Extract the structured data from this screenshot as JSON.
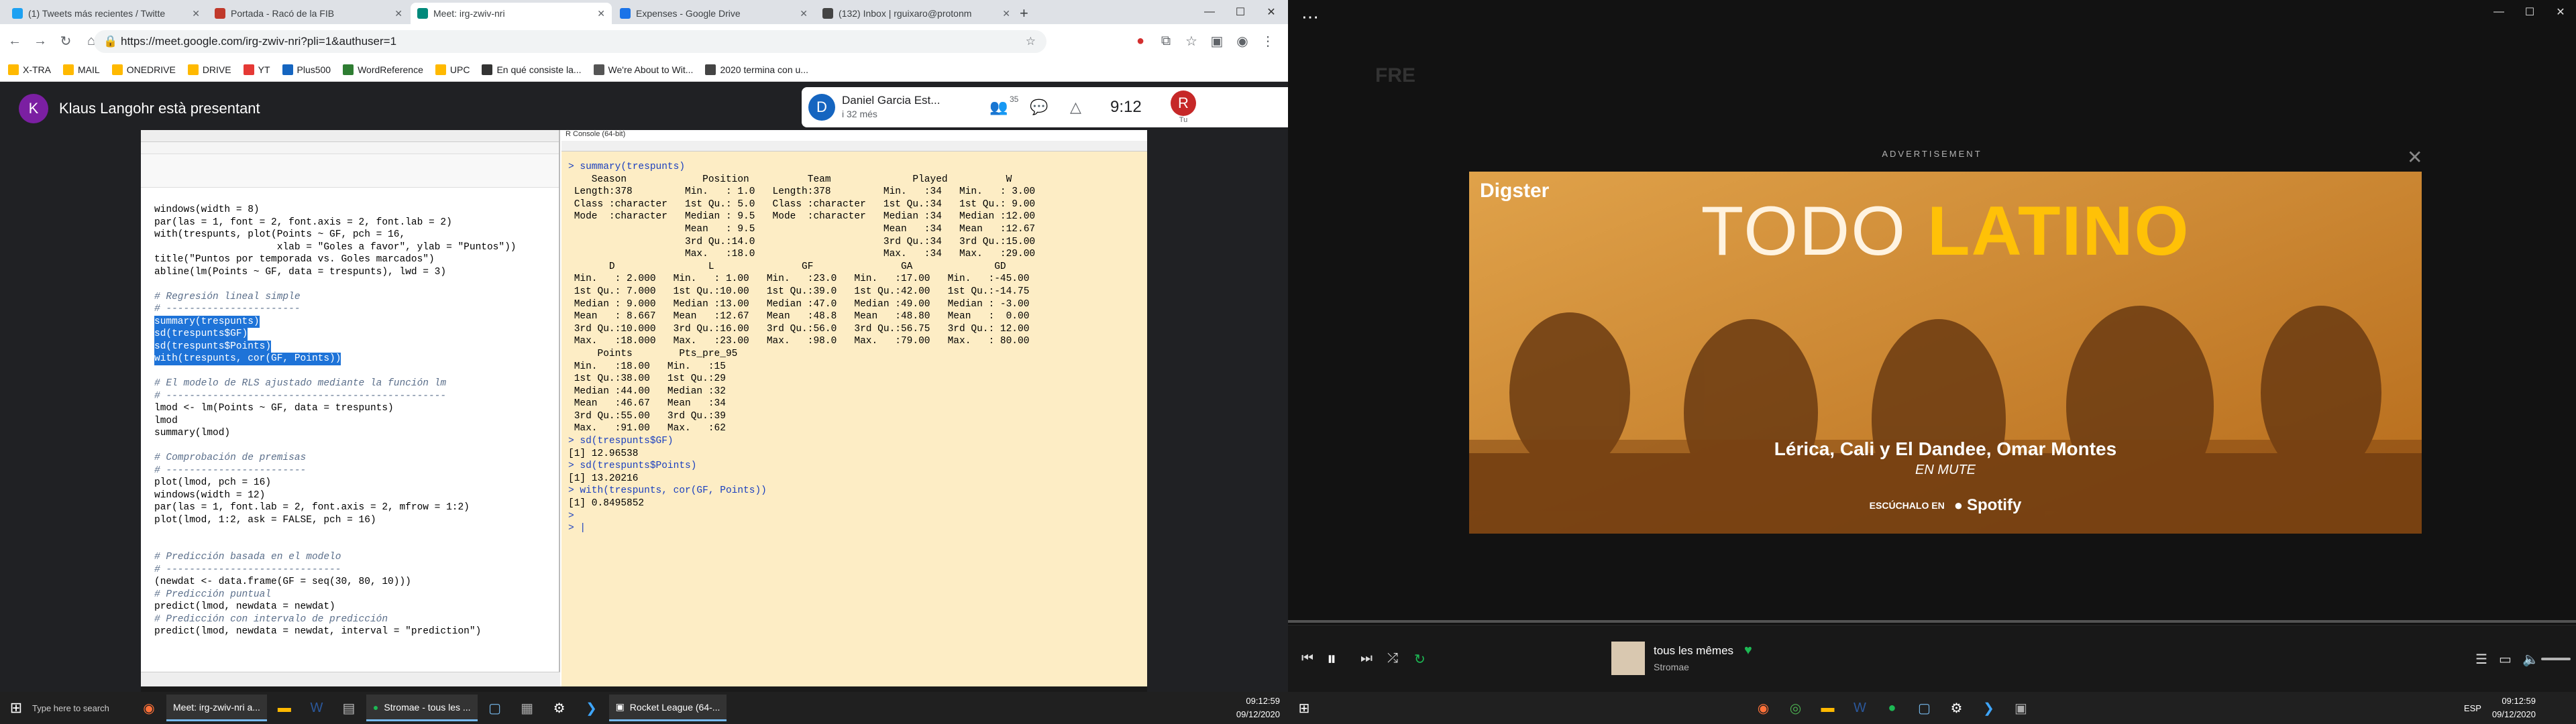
{
  "browser": {
    "tabs": [
      {
        "label": "(1) Tweets más recientes / Twitte",
        "color": "#1da1f2"
      },
      {
        "label": "Portada - Racó de la FIB",
        "color": "#c0392b"
      },
      {
        "label": "Meet: irg-zwiv-nri",
        "color": "#00897b"
      },
      {
        "label": "Expenses - Google Drive",
        "color": "#1a73e8"
      },
      {
        "label": "(132) Inbox | rguixaro@protonm",
        "color": "#444"
      }
    ],
    "url": "https://meet.google.com/irg-zwiv-nri?pli=1&authuser=1",
    "bookmarks": [
      "X-TRA",
      "MAIL",
      "ONEDRIVE",
      "DRIVE",
      "YT",
      "Plus500",
      "WordReference",
      "UPC",
      "En qué consiste la...",
      "We're About to Wit...",
      "2020 termina con u..."
    ]
  },
  "meet": {
    "presenter_initial": "K",
    "presenter_label": "Klaus Langohr està presentant",
    "user_name": "Daniel Garcia Est...",
    "user_sub": "i 32 més",
    "user_initial": "D",
    "participants_count": "35",
    "time": "9:12",
    "self_initial": "R",
    "self_label": "Tu"
  },
  "rstudio": {
    "code_lines": [
      {
        "t": "windows(width = 8)",
        "k": "n"
      },
      {
        "t": "par(las = 1, font = 2, font.axis = 2, font.lab = 2)",
        "k": "n"
      },
      {
        "t": "with(trespunts, plot(Points ~ GF, pch = 16,",
        "k": "n"
      },
      {
        "t": "                     xlab = \"Goles a favor\", ylab = \"Puntos\"))",
        "k": "n"
      },
      {
        "t": "title(\"Puntos por temporada vs. Goles marcados\")",
        "k": "n"
      },
      {
        "t": "abline(lm(Points ~ GF, data = trespunts), lwd = 3)",
        "k": "n"
      },
      {
        "t": "",
        "k": "n"
      },
      {
        "t": "# Regresión lineal simple",
        "k": "c"
      },
      {
        "t": "# -----------------------",
        "k": "c"
      },
      {
        "t": "summary(trespunts)",
        "k": "s"
      },
      {
        "t": "sd(trespunts$GF)",
        "k": "s"
      },
      {
        "t": "sd(trespunts$Points)",
        "k": "s"
      },
      {
        "t": "with(trespunts, cor(GF, Points))",
        "k": "s"
      },
      {
        "t": "",
        "k": "n"
      },
      {
        "t": "# El modelo de RLS ajustado mediante la función lm",
        "k": "c"
      },
      {
        "t": "# ------------------------------------------------",
        "k": "c"
      },
      {
        "t": "lmod <- lm(Points ~ GF, data = trespunts)",
        "k": "n"
      },
      {
        "t": "lmod",
        "k": "n"
      },
      {
        "t": "summary(lmod)",
        "k": "n"
      },
      {
        "t": "",
        "k": "n"
      },
      {
        "t": "# Comprobación de premisas",
        "k": "c"
      },
      {
        "t": "# ------------------------",
        "k": "c"
      },
      {
        "t": "plot(lmod, pch = 16)",
        "k": "n"
      },
      {
        "t": "windows(width = 12)",
        "k": "n"
      },
      {
        "t": "par(las = 1, font.lab = 2, font.axis = 2, mfrow = 1:2)",
        "k": "n"
      },
      {
        "t": "plot(lmod, 1:2, ask = FALSE, pch = 16)",
        "k": "n"
      },
      {
        "t": "",
        "k": "n"
      },
      {
        "t": "",
        "k": "n"
      },
      {
        "t": "# Predicción basada en el modelo",
        "k": "c"
      },
      {
        "t": "# ------------------------------",
        "k": "c"
      },
      {
        "t": "(newdat <- data.frame(GF = seq(30, 80, 10)))",
        "k": "n"
      },
      {
        "t": "# Predicción puntual",
        "k": "c"
      },
      {
        "t": "predict(lmod, newdata = newdat)",
        "k": "n"
      },
      {
        "t": "# Predicción con intervalo de predicción",
        "k": "c"
      },
      {
        "t": "predict(lmod, newdata = newdat, interval = \"prediction\")",
        "k": "n"
      }
    ]
  },
  "rconsole": {
    "title": "R Console (64-bit)",
    "lines": [
      {
        "t": "> summary(trespunts)",
        "k": "i"
      },
      {
        "t": "    Season             Position          Team              Played          W",
        "k": "o"
      },
      {
        "t": " Length:378         Min.   : 1.0   Length:378         Min.   :34   Min.   : 3.00",
        "k": "o"
      },
      {
        "t": " Class :character   1st Qu.: 5.0   Class :character   1st Qu.:34   1st Qu.: 9.00",
        "k": "o"
      },
      {
        "t": " Mode  :character   Median : 9.5   Mode  :character   Median :34   Median :12.00",
        "k": "o"
      },
      {
        "t": "                    Mean   : 9.5                      Mean   :34   Mean   :12.67",
        "k": "o"
      },
      {
        "t": "                    3rd Qu.:14.0                      3rd Qu.:34   3rd Qu.:15.00",
        "k": "o"
      },
      {
        "t": "                    Max.   :18.0                      Max.   :34   Max.   :29.00",
        "k": "o"
      },
      {
        "t": "       D                L               GF               GA              GD",
        "k": "o"
      },
      {
        "t": " Min.   : 2.000   Min.   : 1.00   Min.   :23.0   Min.   :17.00   Min.   :-45.00",
        "k": "o"
      },
      {
        "t": " 1st Qu.: 7.000   1st Qu.:10.00   1st Qu.:39.0   1st Qu.:42.00   1st Qu.:-14.75",
        "k": "o"
      },
      {
        "t": " Median : 9.000   Median :13.00   Median :47.0   Median :49.00   Median : -3.00",
        "k": "o"
      },
      {
        "t": " Mean   : 8.667   Mean   :12.67   Mean   :48.8   Mean   :48.80   Mean   :  0.00",
        "k": "o"
      },
      {
        "t": " 3rd Qu.:10.000   3rd Qu.:16.00   3rd Qu.:56.0   3rd Qu.:56.75   3rd Qu.: 12.00",
        "k": "o"
      },
      {
        "t": " Max.   :18.000   Max.   :23.00   Max.   :98.0   Max.   :79.00   Max.   : 80.00",
        "k": "o"
      },
      {
        "t": "     Points        Pts_pre_95",
        "k": "o"
      },
      {
        "t": " Min.   :18.00   Min.   :15",
        "k": "o"
      },
      {
        "t": " 1st Qu.:38.00   1st Qu.:29",
        "k": "o"
      },
      {
        "t": " Median :44.00   Median :32",
        "k": "o"
      },
      {
        "t": " Mean   :46.67   Mean   :34",
        "k": "o"
      },
      {
        "t": " 3rd Qu.:55.00   3rd Qu.:39",
        "k": "o"
      },
      {
        "t": " Max.   :91.00   Max.   :62",
        "k": "o"
      },
      {
        "t": "> sd(trespunts$GF)",
        "k": "i"
      },
      {
        "t": "[1] 12.96538",
        "k": "o"
      },
      {
        "t": "> sd(trespunts$Points)",
        "k": "i"
      },
      {
        "t": "[1] 13.20216",
        "k": "o"
      },
      {
        "t": "> with(trespunts, cor(GF, Points))",
        "k": "i"
      },
      {
        "t": "[1] 0.8495852",
        "k": "o"
      },
      {
        "t": ">",
        "k": "i"
      },
      {
        "t": "> |",
        "k": "i"
      }
    ]
  },
  "taskbar_left": {
    "search_placeholder": "Type here to search",
    "apps": [
      "Meet: irg-zwiv-nri a...",
      "Stromae - tous les ...",
      "Rocket League (64-..."
    ],
    "time": "09:12:59",
    "date": "09/12/2020"
  },
  "spotify": {
    "advert_label": "ADVERTISEMENT",
    "ad_brand": "Digster",
    "ad_title_1": "TODO ",
    "ad_title_2": "LATINO",
    "ad_artists": "Lérica, Cali y El Dandee, Omar Montes",
    "ad_sub": "EN MUTE",
    "ad_cta": "ESCÚCHALO EN",
    "ad_cta_brand": "Spotify",
    "track_title": "tous les mêmes",
    "track_artist": "Stromae",
    "bg_header": "FRE"
  },
  "taskbar_right": {
    "lang": "ESP",
    "time": "09:12:59",
    "date": "09/12/2020"
  }
}
